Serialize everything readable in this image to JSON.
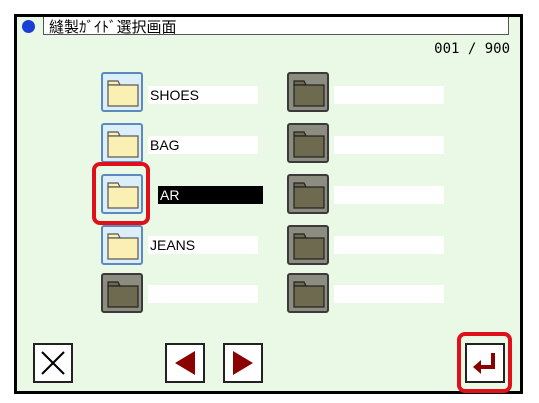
{
  "header": {
    "title": "縫製ｶﾞｲﾄﾞ選択画面",
    "page_counter": "001 / 900"
  },
  "folders_left": [
    {
      "label": "SHOES",
      "state": "active"
    },
    {
      "label": "BAG",
      "state": "active"
    },
    {
      "label": "AR",
      "state": "selected"
    },
    {
      "label": "JEANS",
      "state": "active"
    },
    {
      "label": "",
      "state": "empty"
    }
  ],
  "folders_right": [
    {
      "label": "",
      "state": "empty"
    },
    {
      "label": "",
      "state": "empty"
    },
    {
      "label": "",
      "state": "empty"
    },
    {
      "label": "",
      "state": "empty"
    },
    {
      "label": "",
      "state": "empty"
    }
  ],
  "footer": {
    "close_icon": "close-icon",
    "prev_icon": "triangle-left-icon",
    "next_icon": "triangle-right-icon",
    "enter_icon": "enter-arrow-icon"
  },
  "colors": {
    "background": "#e9f9e6",
    "accent_red": "#e0101a",
    "dot_blue": "#1a3fd6",
    "folder_yellow": "#faf0b4",
    "folder_empty": "#8c8c80",
    "arrow_dark_red": "#8b0000"
  }
}
